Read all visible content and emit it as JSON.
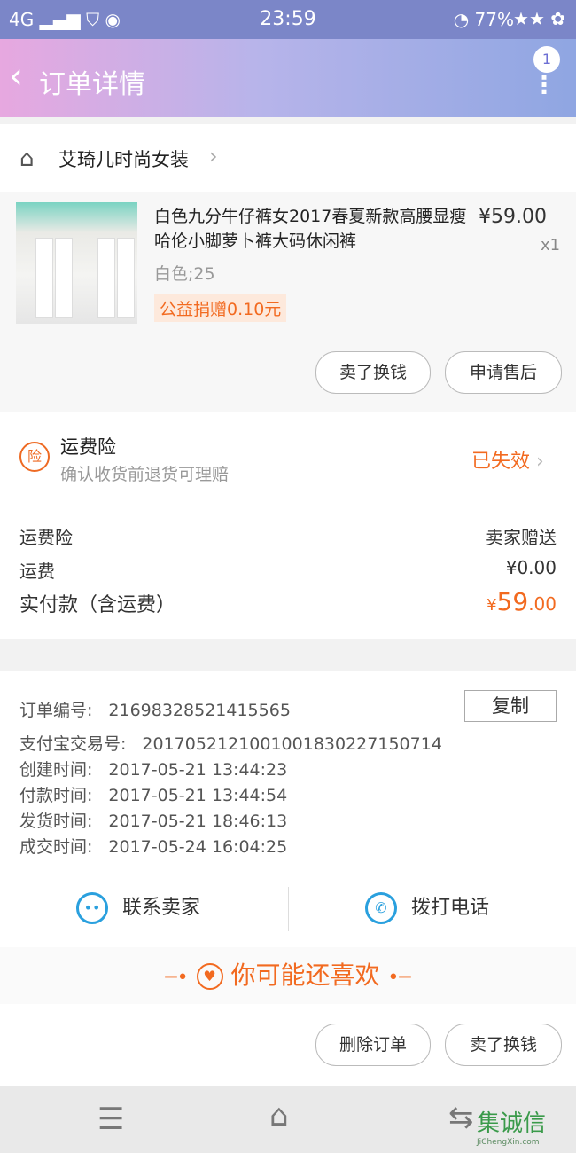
{
  "status": {
    "signal": "4G",
    "time": "23:59",
    "battery": "77%"
  },
  "nav": {
    "title": "订单详情",
    "badge": "1"
  },
  "store": {
    "name": "艾琦儿时尚女装"
  },
  "product": {
    "title": "白色九分牛仔裤女2017春夏新款高腰显瘦哈伦小脚萝卜裤大码休闲裤",
    "price": "¥59.00",
    "quantity": "x1",
    "sku": "白色;25",
    "donation": "公益捐赠0.10元",
    "btn_sell": "卖了换钱",
    "btn_aftersale": "申请售后"
  },
  "insurance": {
    "icon_text": "险",
    "title": "运费险",
    "subtitle": "确认收货前退货可理赔",
    "status": "已失效",
    "rows": [
      {
        "label": "运费险",
        "value": "卖家赠送"
      },
      {
        "label": "运费",
        "value": "¥0.00"
      }
    ],
    "total_label": "实付款（含运费）",
    "total_currency": "¥",
    "total_int": "59",
    "total_dec": ".00"
  },
  "order": {
    "order_no_label": "订单编号:",
    "order_no": "21698328521415565",
    "copy": "复制",
    "alipay_label": "支付宝交易号:",
    "alipay_no": "2017052121001001830227150714",
    "created_label": "创建时间:",
    "created": "2017-05-21 13:44:23",
    "paid_label": "付款时间:",
    "paid": "2017-05-21 13:44:54",
    "shipped_label": "发货时间:",
    "shipped": "2017-05-21 18:46:13",
    "done_label": "成交时间:",
    "done": "2017-05-24 16:04:25",
    "contact_seller": "联系卖家",
    "call_phone": "拨打电话"
  },
  "recommend": {
    "title": "你可能还喜欢"
  },
  "bottom": {
    "delete_order": "删除订单",
    "sell": "卖了换钱"
  },
  "watermark": {
    "text": "集诚信",
    "url": "JiChengXin.com"
  },
  "colors": {
    "accent": "#f26a20",
    "link_blue": "#2aa0de"
  }
}
